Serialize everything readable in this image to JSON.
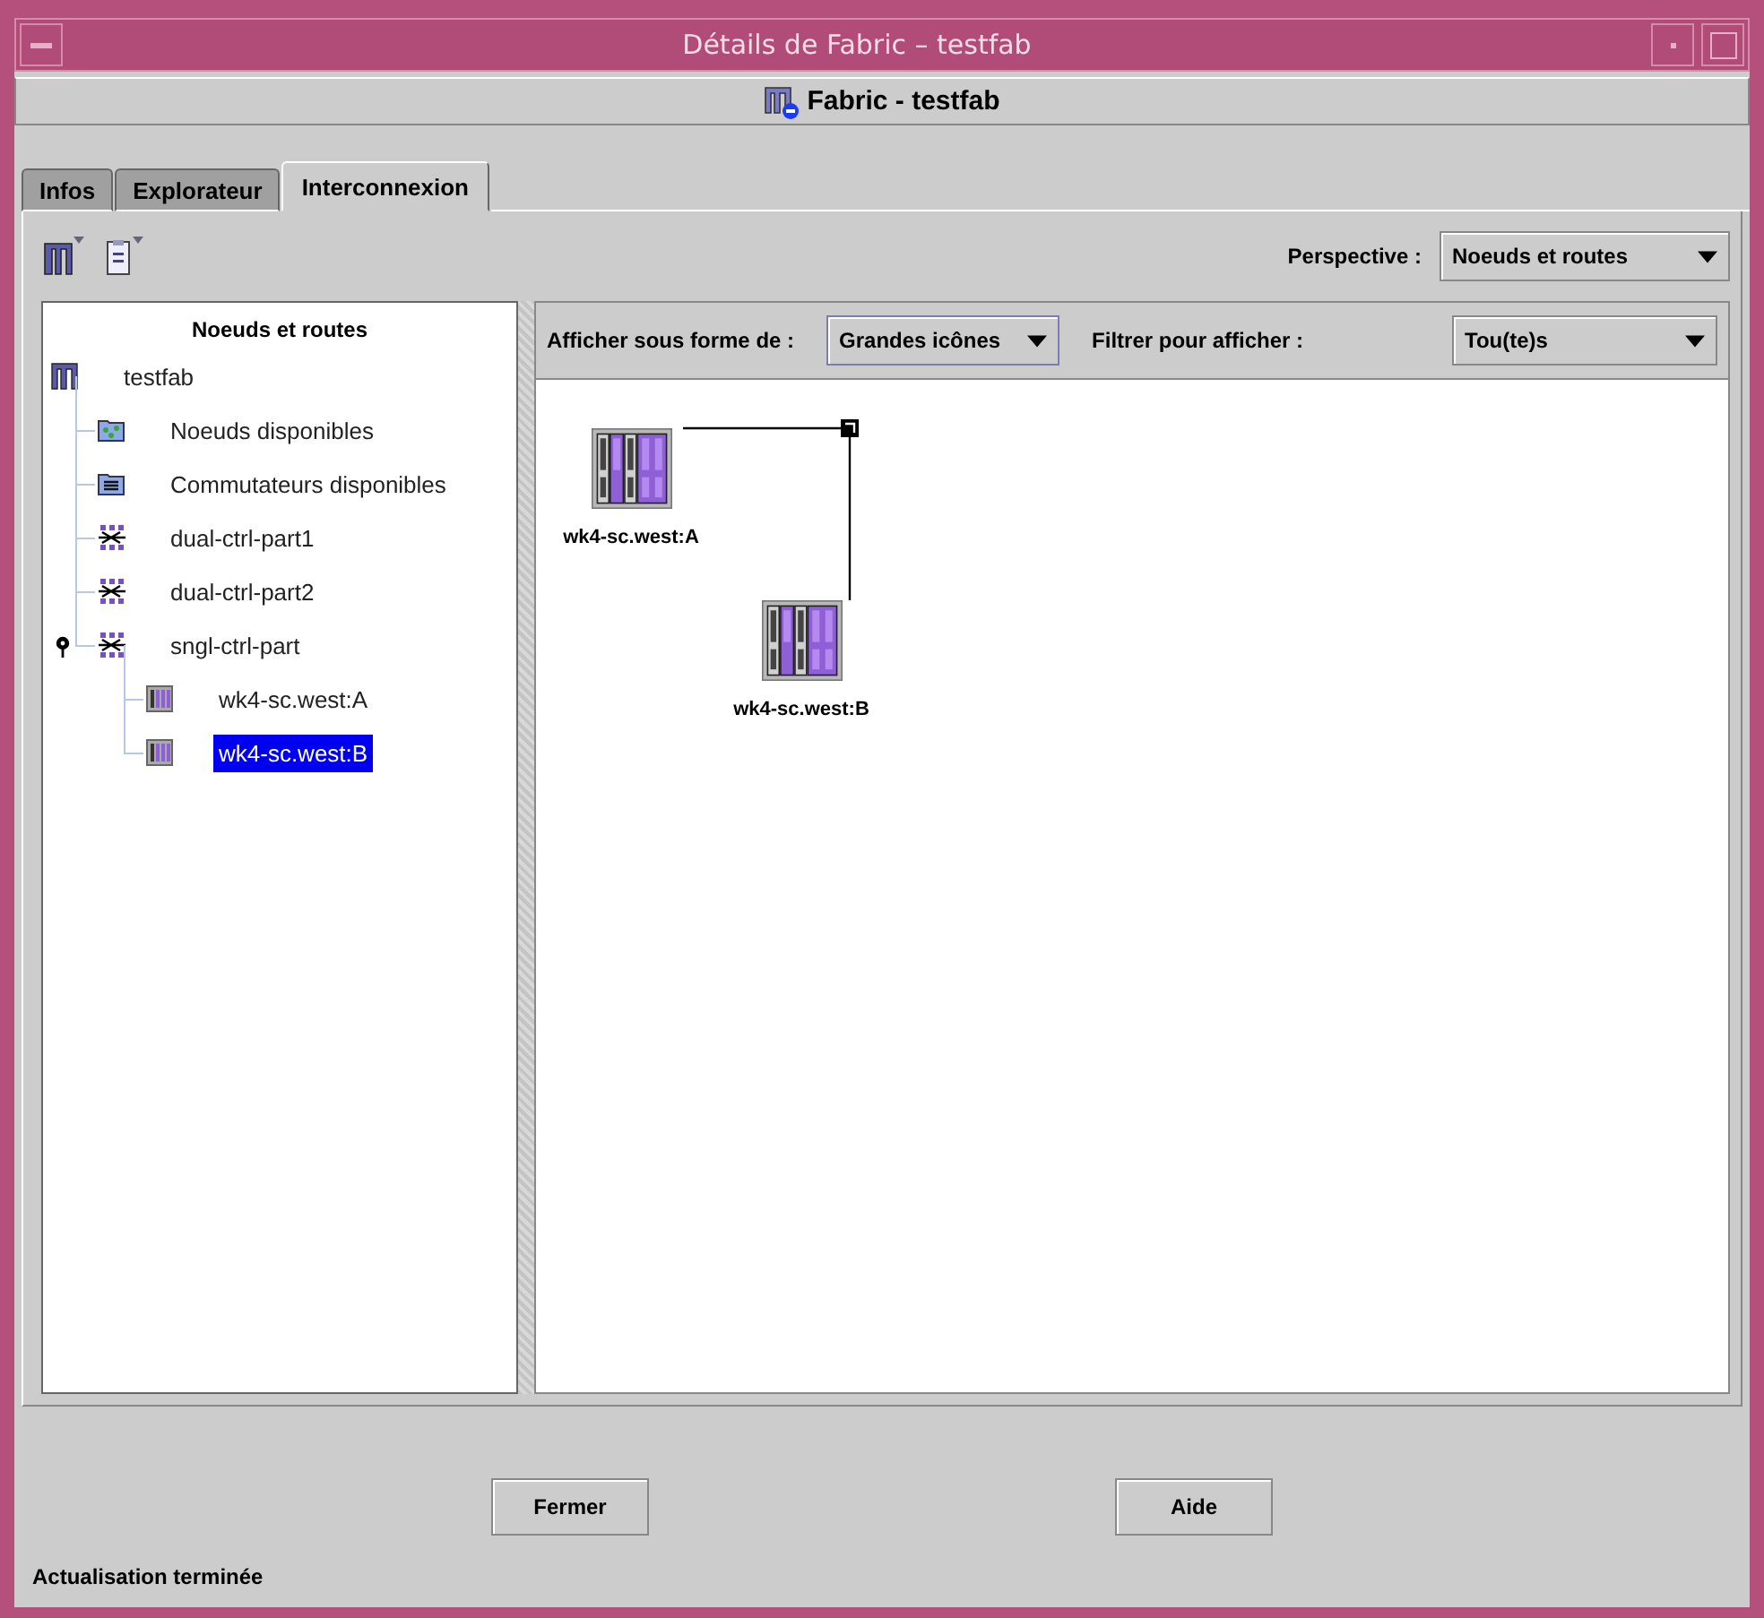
{
  "window": {
    "title": "Détails de Fabric – testfab"
  },
  "header": {
    "title": "Fabric - testfab"
  },
  "tabs": [
    {
      "label": "Infos",
      "selected": false
    },
    {
      "label": "Explorateur",
      "selected": false
    },
    {
      "label": "Interconnexion",
      "selected": true
    }
  ],
  "perspective": {
    "label": "Perspective :",
    "value": "Noeuds et routes"
  },
  "tree": {
    "title": "Noeuds et routes",
    "items": [
      {
        "label": "testfab",
        "kind": "fabric",
        "selected": false,
        "children": [
          {
            "label": "Noeuds disponibles",
            "kind": "nodes-folder",
            "selected": false
          },
          {
            "label": "Commutateurs disponibles",
            "kind": "switch-folder",
            "selected": false
          },
          {
            "label": "dual-ctrl-part1",
            "kind": "partition",
            "selected": false
          },
          {
            "label": "dual-ctrl-part2",
            "kind": "partition",
            "selected": false
          },
          {
            "label": "sngl-ctrl-part",
            "kind": "partition",
            "selected": false,
            "expanded": true,
            "children": [
              {
                "label": "wk4-sc.west:A",
                "kind": "node",
                "selected": false
              },
              {
                "label": "wk4-sc.west:B",
                "kind": "node",
                "selected": true
              }
            ]
          }
        ]
      }
    ]
  },
  "view": {
    "display_label": "Afficher sous forme de :",
    "display_value": "Grandes icônes",
    "filter_label": "Filtrer pour afficher :",
    "filter_value": "Tou(te)s"
  },
  "canvas": {
    "nodes": [
      {
        "label": "wk4-sc.west:A"
      },
      {
        "label": "wk4-sc.west:B"
      }
    ]
  },
  "buttons": [
    "Fermer",
    "Aide"
  ],
  "status_bar": "Actualisation terminée"
}
